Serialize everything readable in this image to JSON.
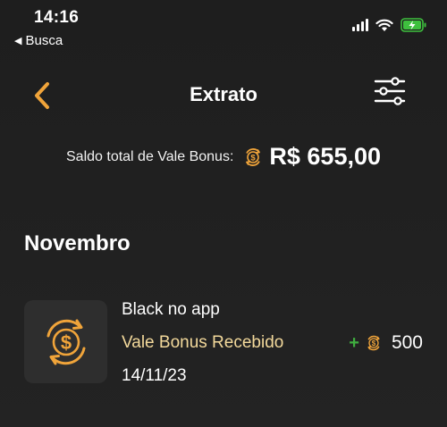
{
  "status_bar": {
    "time": "14:16",
    "back_app": "Busca",
    "battery_color": "#3ec03e"
  },
  "nav": {
    "title": "Extrato",
    "accent": "#f0a43a"
  },
  "balance": {
    "label": "Saldo total de Vale Bonus:",
    "amount": "R$ 655,00"
  },
  "month": "Novembro",
  "transactions": [
    {
      "title": "Black no app",
      "type": "Vale Bonus Recebido",
      "date": "14/11/23",
      "sign": "+",
      "value": "500"
    }
  ],
  "icons": {
    "back": "chevron-left-icon",
    "filter": "sliders-icon",
    "coin": "dollar-cycle-coin-icon"
  }
}
